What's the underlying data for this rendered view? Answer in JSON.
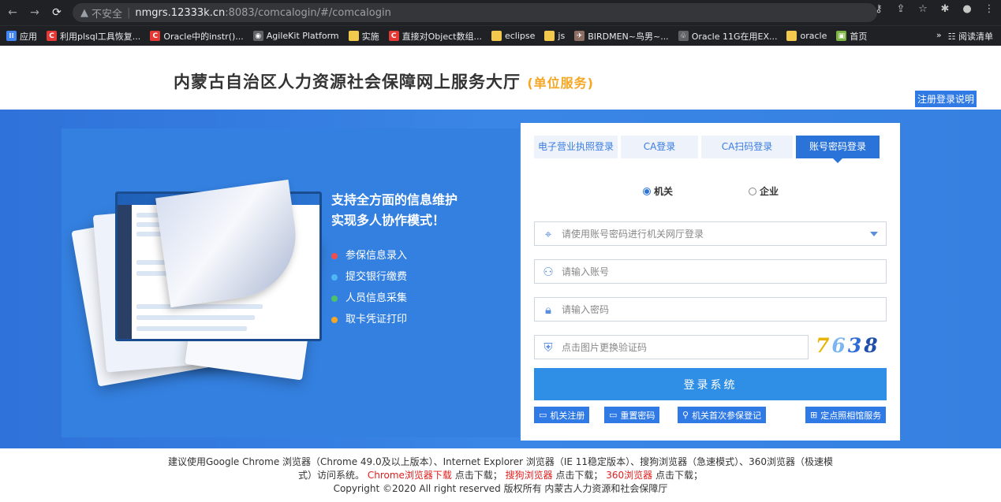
{
  "browser": {
    "unsafe_label": "不安全",
    "url_host": "nmgrs.12333k.cn",
    "url_path": ":8083/comcalogin/#/comcalogin",
    "bookmarks": [
      {
        "label": "应用",
        "icon": "apps-icon",
        "color": "#4285f4"
      },
      {
        "label": "利用plsql工具恢复...",
        "icon": "c-icon",
        "color": "#e53935"
      },
      {
        "label": "Oracle中的instr()...",
        "icon": "c-icon",
        "color": "#e53935"
      },
      {
        "label": "AgileKit Platform",
        "icon": "globe-icon",
        "color": "#5f6368"
      },
      {
        "label": "实施",
        "icon": "folder-icon",
        "color": "#f2c94c"
      },
      {
        "label": "直接对Object数组...",
        "icon": "c-icon",
        "color": "#e53935"
      },
      {
        "label": "eclipse",
        "icon": "folder-icon",
        "color": "#f2c94c"
      },
      {
        "label": "js",
        "icon": "folder-icon",
        "color": "#f2c94c"
      },
      {
        "label": "BIRDMEN~鸟男~...",
        "icon": "bird-icon",
        "color": "#8d6e63"
      },
      {
        "label": "Oracle 11G在用EX...",
        "icon": "paw-icon",
        "color": "#5f6368"
      },
      {
        "label": "oracle",
        "icon": "folder-icon",
        "color": "#f2c94c"
      },
      {
        "label": "首页",
        "icon": "image-icon",
        "color": "#7cb342"
      }
    ],
    "more_label": "»",
    "reading_list_label": "阅读清单"
  },
  "header": {
    "title": "内蒙古自治区人力资源社会保障网上服务大厅",
    "subtitle": "(单位服务)",
    "help_link": "注册登录说明"
  },
  "banner": {
    "headline_1": "支持全方面的信息维护",
    "headline_2": "实现多人协作模式！",
    "features": [
      {
        "label": "参保信息录入",
        "color": "#f04e4e"
      },
      {
        "label": "提交银行缴费",
        "color": "#4fb6f5"
      },
      {
        "label": "人员信息采集",
        "color": "#4cc36a"
      },
      {
        "label": "取卡凭证打印",
        "color": "#f5a623"
      }
    ]
  },
  "login": {
    "tabs": [
      {
        "label": "电子营业执照登录",
        "active": false
      },
      {
        "label": "CA登录",
        "active": false
      },
      {
        "label": "CA扫码登录",
        "active": false
      },
      {
        "label": "账号密码登录",
        "active": true
      }
    ],
    "radio_org": "机关",
    "radio_company": "企业",
    "selected_radio": "机关",
    "select_placeholder": "请使用账号密码进行机关网厅登录",
    "account_placeholder": "请输入账号",
    "password_placeholder": "请输入密码",
    "captcha_placeholder": "点击图片更换验证码",
    "captcha_code": [
      "7",
      "6",
      "3",
      "8"
    ],
    "submit_label": "登录系统",
    "sub_buttons": [
      {
        "label": "机关注册",
        "icon": "monitor-icon"
      },
      {
        "label": "重置密码",
        "icon": "monitor-icon"
      },
      {
        "label": "机关首次参保登记",
        "icon": "search-icon"
      },
      {
        "label": "定点照相馆服务",
        "icon": "plus-square-icon"
      }
    ]
  },
  "footer": {
    "line1_a": "建议使用Google Chrome 浏览器（Chrome 49.0及以上版本）、Internet Explorer 浏览器（IE 11稳定版本）、搜狗浏览器（急速模式）、360浏览器（极速模",
    "line2_a": "式）访问系统。",
    "chrome_dl": "Chrome浏览器下载",
    "click_dl_1": "点击下载；",
    "sogou_dl": "搜狗浏览器",
    "click_dl_2": "点击下载；",
    "qihoo_dl": "360浏览器",
    "click_dl_3": "点击下载；",
    "copyright": "Copyright ©2020 All right reserved 版权所有 内蒙古人力资源和社会保障厅"
  }
}
